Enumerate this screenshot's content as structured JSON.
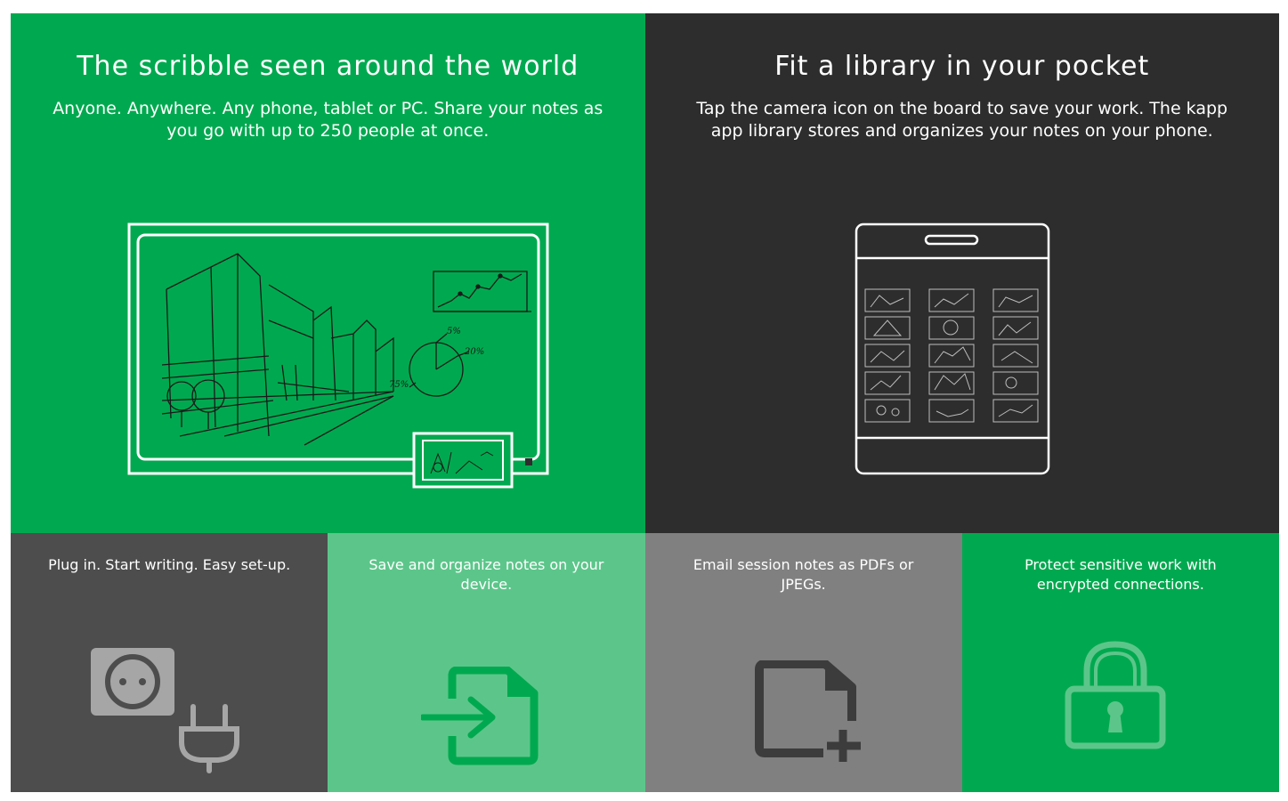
{
  "hero_left": {
    "title": "The scribble seen around the world",
    "description": "Anyone. Anywhere. Any phone, tablet or PC. Share your notes as you go with up to 250 people at once.",
    "illustration_icon": "whiteboard-sketch-icon",
    "sketch_labels": [
      "5%",
      "20%",
      "75%"
    ]
  },
  "hero_right": {
    "title": "Fit a library in your pocket",
    "description": "Tap the camera icon on the board to save your work. The kapp app library stores and organizes your notes on your phone.",
    "illustration_icon": "phone-library-icon"
  },
  "features": [
    {
      "text": "Plug in. Start writing. Easy set-up.",
      "icon": "power-plug-icon",
      "color": "#4d4d4d"
    },
    {
      "text": "Save and organize notes on your device.",
      "icon": "file-import-icon",
      "color": "#5cc68a"
    },
    {
      "text": "Email session notes as PDFs or JPEGs.",
      "icon": "file-add-icon",
      "color": "#808080"
    },
    {
      "text": "Protect sensitive work with encrypted connections.",
      "icon": "padlock-icon",
      "color": "#00a94f"
    }
  ],
  "colors": {
    "brand_green": "#00a94f",
    "dark": "#2d2d2d",
    "light_green": "#5cc68a",
    "gray": "#808080",
    "dark_gray": "#4d4d4d"
  }
}
